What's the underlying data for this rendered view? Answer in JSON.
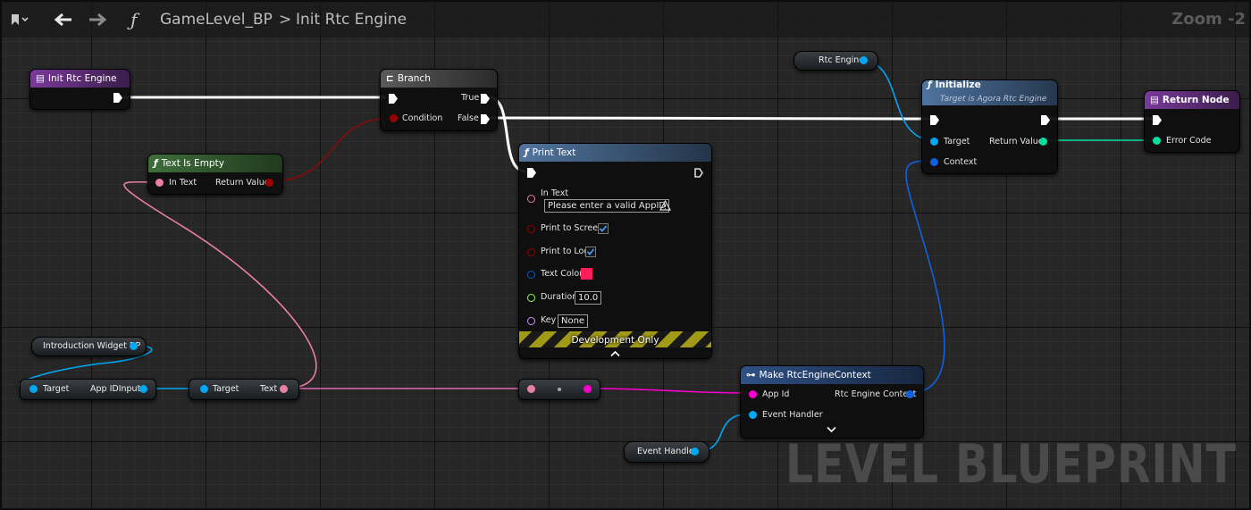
{
  "toolbar": {
    "bookmark_icon": "bookmark-icon",
    "back_icon": "arrow-left-icon",
    "forward_icon": "arrow-right-icon",
    "function_icon": "function-icon",
    "blueprint": "GameLevel_BP",
    "separator": ">",
    "function_name": "Init Rtc Engine",
    "zoom": "Zoom -2"
  },
  "watermark": "LEVEL BLUEPRINT",
  "colors": {
    "exec": "#ffffff",
    "bool": "#9a0000",
    "object": "#00a8f4",
    "text": "#e97fa2",
    "string": "#fb00d0",
    "struct": "#1060e0",
    "color_struct": "#0058c8",
    "float": "#90ff4d",
    "name": "#c993ff",
    "enum": "#00e0a0",
    "function_header": "#5a7aa8",
    "pure_header": "#3a6a36",
    "event_header": "#7a3a9a",
    "branch_header": "#555555",
    "make_header": "#2a4a78"
  },
  "nodes": {
    "init_rtc_engine": {
      "title": "Init Rtc Engine"
    },
    "branch": {
      "title": "Branch",
      "true": "True",
      "condition": "Condition",
      "false": "False"
    },
    "text_is_empty": {
      "title": "Text Is Empty",
      "in_text": "In Text",
      "return_value": "Return Value"
    },
    "print_text": {
      "title": "Print Text",
      "in_text": "In Text",
      "in_text_value": "Please enter a valid AppID",
      "print_to_screen": "Print to Screen",
      "print_to_log": "Print to Log",
      "text_color": "Text Color",
      "text_color_value": "#ff1d5a",
      "duration": "Duration",
      "duration_value": "10.0",
      "key": "Key",
      "key_value": "None",
      "dev_only": "Development Only"
    },
    "rtc_engine_var": {
      "label": "Rtc Engine"
    },
    "initialize": {
      "title": "Initialize",
      "subtitle": "Target is Agora Rtc Engine",
      "target": "Target",
      "return_value": "Return Value",
      "context": "Context"
    },
    "return_node": {
      "title": "Return Node",
      "error_code": "Error Code"
    },
    "intro_widget": {
      "label": "Introduction Widget BP"
    },
    "get_app_id": {
      "target": "Target",
      "output": "App IDInput"
    },
    "get_text": {
      "target": "Target",
      "output": "Text"
    },
    "make_context": {
      "title": "Make RtcEngineContext",
      "app_id": "App Id",
      "event_handler": "Event Handler",
      "rtc_context": "Rtc Engine Context"
    },
    "event_handler_var": {
      "label": "Event Handler"
    }
  }
}
